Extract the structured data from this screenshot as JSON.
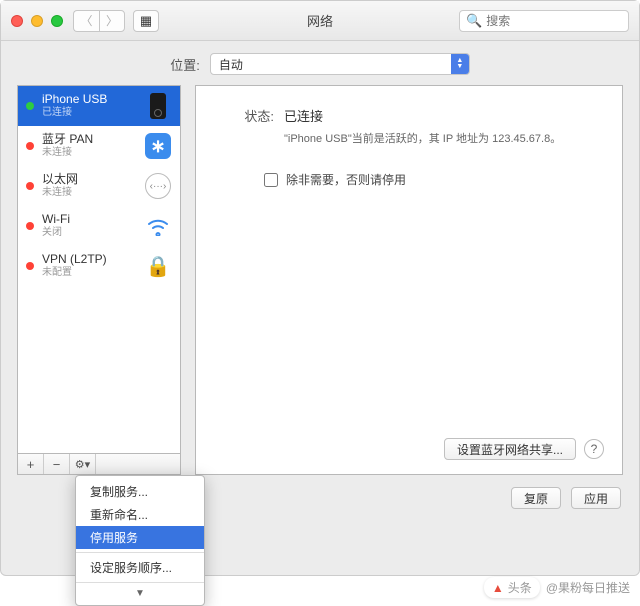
{
  "window": {
    "title": "网络",
    "search_placeholder": "搜索"
  },
  "location": {
    "label": "位置:",
    "value": "自动"
  },
  "sidebar": {
    "items": [
      {
        "name": "iPhone USB",
        "status": "已连接",
        "dot": "green",
        "icon": "phone"
      },
      {
        "name": "蓝牙 PAN",
        "status": "未连接",
        "dot": "red",
        "icon": "bluetooth"
      },
      {
        "name": "以太网",
        "status": "未连接",
        "dot": "red",
        "icon": "ethernet"
      },
      {
        "name": "Wi-Fi",
        "status": "关闭",
        "dot": "red",
        "icon": "wifi"
      },
      {
        "name": "VPN (L2TP)",
        "status": "未配置",
        "dot": "red",
        "icon": "lock"
      }
    ]
  },
  "toolbar": {
    "add": "+",
    "remove": "−",
    "gear": "⚙︎▾"
  },
  "detail": {
    "status_label": "状态:",
    "status_value": "已连接",
    "description": "\"iPhone USB\"当前是活跃的，其 IP 地址为 123.45.67.8。",
    "checkbox_label": "除非需要，否则请停用",
    "share_button": "设置蓝牙网络共享...",
    "help": "?"
  },
  "buttons": {
    "revert": "复原",
    "apply": "应用"
  },
  "context_menu": {
    "items": [
      "复制服务...",
      "重新命名...",
      "停用服务",
      "设定服务顺序..."
    ],
    "highlight_index": 2
  },
  "watermark": {
    "prefix": "头条",
    "text": "@果粉每日推送"
  }
}
